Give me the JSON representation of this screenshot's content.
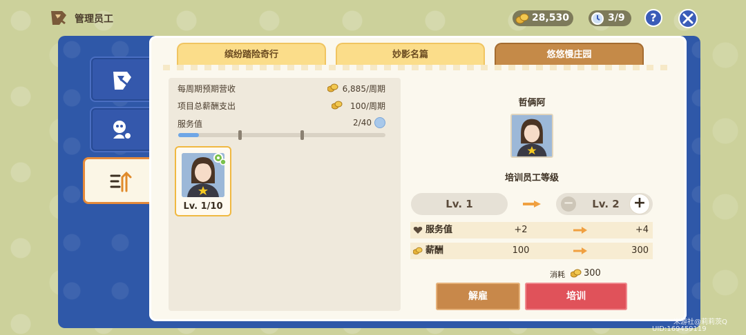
{
  "header": {
    "title": "管理员工",
    "currency": "28,530",
    "staff_count": "3/9",
    "help_label": "?"
  },
  "tabs": [
    {
      "label": "缤纷踏险奇行",
      "active": false
    },
    {
      "label": "妙影名篇",
      "active": false
    },
    {
      "label": "悠悠慢庄园",
      "active": true
    }
  ],
  "summary": {
    "weekly_revenue_label": "每周期预期营收",
    "weekly_revenue_value": "6,885/周期",
    "salary_label": "项目总薪酬支出",
    "salary_value": "100/周期",
    "service_label": "服务值",
    "service_value": "2/40",
    "service_progress": 0.05
  },
  "employee_card": {
    "level": "Lv. 1/10"
  },
  "detail": {
    "name": "哲俩阿",
    "section_title": "培训员工等级",
    "level_from": "Lv. 1",
    "level_to": "Lv. 2",
    "minus": "−",
    "plus": "+",
    "stats": [
      {
        "label": "服务值",
        "from": "+2",
        "to": "+4"
      },
      {
        "label": "薪酬",
        "from": "100",
        "to": "300"
      }
    ],
    "cost_label": "消耗",
    "cost_value": "300",
    "fire_button": "解雇",
    "train_button": "培训"
  },
  "watermark": {
    "line1": "米游社@莉莉茨Q",
    "line2": "UID:169459119"
  },
  "colors": {
    "accent_blue": "#2f58a8",
    "tab_gold": "#fbdd8a",
    "tab_active": "#c58a48",
    "train_red": "#e0525a",
    "fire_brown": "#c8884a",
    "progress_blue": "#6ea6e6"
  }
}
